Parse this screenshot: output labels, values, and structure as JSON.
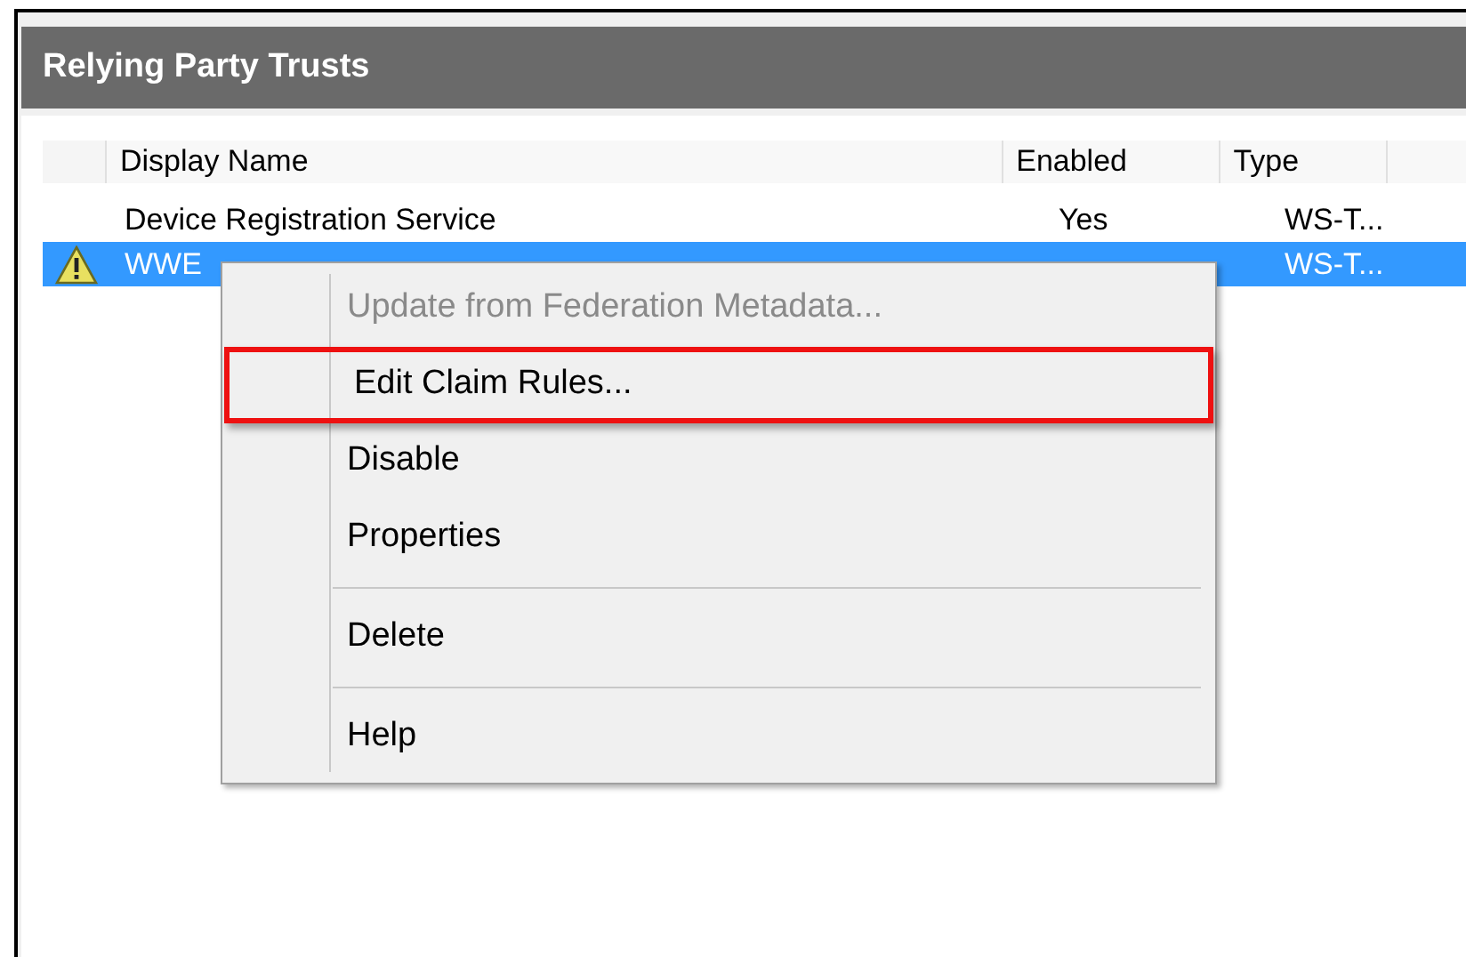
{
  "panel": {
    "title": "Relying Party Trusts"
  },
  "table": {
    "columns": [
      "Display Name",
      "Enabled",
      "Type"
    ],
    "rows": [
      {
        "warning": false,
        "selected": false,
        "cells": [
          "Device Registration Service",
          "Yes",
          "WS-T..."
        ]
      },
      {
        "warning": true,
        "selected": true,
        "cells": [
          "WWE",
          "",
          "WS-T..."
        ]
      }
    ]
  },
  "context_menu": {
    "items": [
      {
        "kind": "item",
        "label": "Update from Federation Metadata...",
        "disabled": true,
        "highlighted": false
      },
      {
        "kind": "item",
        "label": "Edit Claim Rules...",
        "disabled": false,
        "highlighted": true
      },
      {
        "kind": "item",
        "label": "Disable",
        "disabled": false,
        "highlighted": false
      },
      {
        "kind": "item",
        "label": "Properties",
        "disabled": false,
        "highlighted": false
      },
      {
        "kind": "separator"
      },
      {
        "kind": "item",
        "label": "Delete",
        "disabled": false,
        "highlighted": false
      },
      {
        "kind": "separator"
      },
      {
        "kind": "item",
        "label": "Help",
        "disabled": false,
        "highlighted": false
      }
    ]
  }
}
